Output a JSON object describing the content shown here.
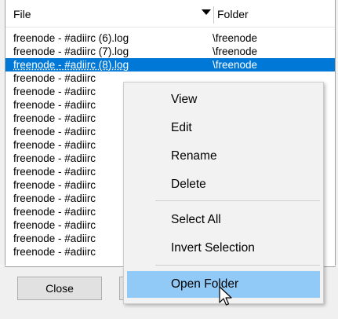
{
  "list": {
    "columns": {
      "file": "File",
      "folder": "Folder"
    },
    "rows": [
      {
        "file": "freenode - #adiirc (6).log",
        "folder": "\\freenode",
        "selected": false
      },
      {
        "file": "freenode - #adiirc (7).log",
        "folder": "\\freenode",
        "selected": false
      },
      {
        "file": "freenode - #adiirc (8).log",
        "folder": "\\freenode",
        "selected": true
      },
      {
        "file": "freenode - #adiirc",
        "folder": "",
        "selected": false
      },
      {
        "file": "freenode - #adiirc",
        "folder": "",
        "selected": false
      },
      {
        "file": "freenode - #adiirc",
        "folder": "",
        "selected": false
      },
      {
        "file": "freenode - #adiirc",
        "folder": "",
        "selected": false
      },
      {
        "file": "freenode - #adiirc",
        "folder": "",
        "selected": false
      },
      {
        "file": "freenode - #adiirc",
        "folder": "",
        "selected": false
      },
      {
        "file": "freenode - #adiirc",
        "folder": "",
        "selected": false
      },
      {
        "file": "freenode - #adiirc",
        "folder": "",
        "selected": false
      },
      {
        "file": "freenode - #adiirc",
        "folder": "",
        "selected": false
      },
      {
        "file": "freenode - #adiirc",
        "folder": "",
        "selected": false
      },
      {
        "file": "freenode - #adiirc",
        "folder": "",
        "selected": false
      },
      {
        "file": "freenode - #adiirc",
        "folder": "",
        "selected": false
      },
      {
        "file": "freenode - #adiirc",
        "folder": "",
        "selected": false
      },
      {
        "file": "freenode - #adiirc",
        "folder": "",
        "selected": false
      }
    ]
  },
  "buttons": {
    "close": "Close"
  },
  "context_menu": {
    "groups": [
      [
        "View",
        "Edit",
        "Rename",
        "Delete"
      ],
      [
        "Select All",
        "Invert Selection"
      ],
      [
        "Open Folder"
      ]
    ],
    "hovered": "Open Folder"
  },
  "colors": {
    "selection": "#0078d7",
    "menu_hover": "#91c9f7"
  }
}
